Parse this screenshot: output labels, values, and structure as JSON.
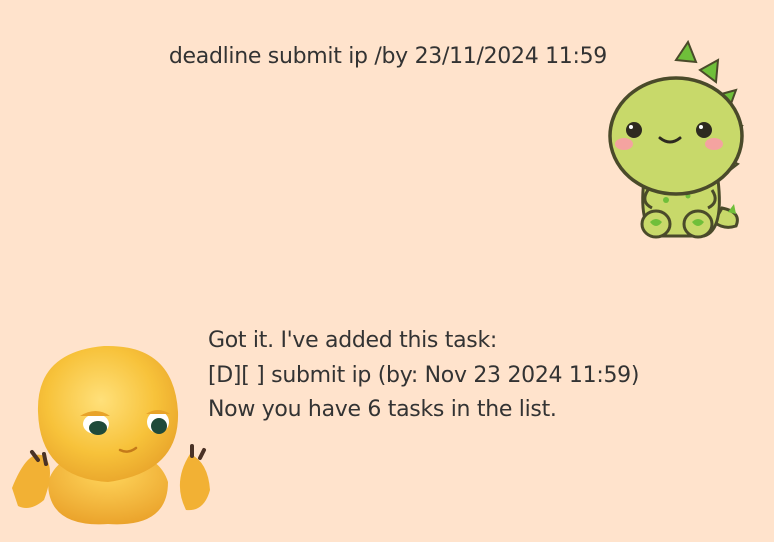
{
  "dialog": {
    "user_message": {
      "text": "deadline submit ip /by 23/11/2024 11:59",
      "avatar_icon": "green-dinosaur-icon"
    },
    "bot_message": {
      "lines": [
        "Got it. I've added this task:",
        "[D][ ] submit ip (by: Nov 23 2024 11:59)",
        "Now you have 6 tasks in the list."
      ],
      "avatar_icon": "yellow-lizard-icon"
    }
  },
  "colors": {
    "background": "#ffe3cc",
    "text": "#333333",
    "dino_body": "#c8d96a",
    "dino_spikes": "#6fbf3a",
    "lizard_body": "#f7c23a"
  }
}
